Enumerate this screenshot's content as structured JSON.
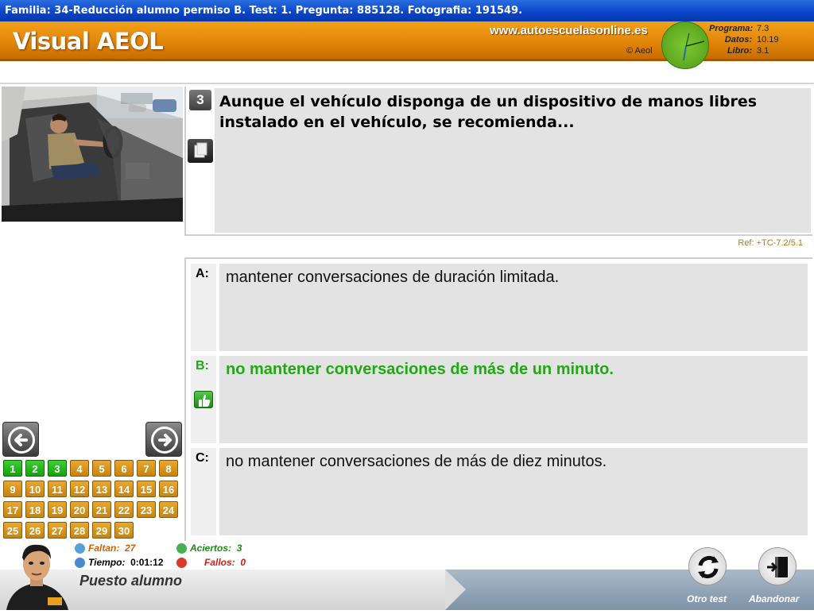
{
  "window": {
    "title": "Familia: 34-Reducción alumno permiso B. Test: 1. Pregunta: 885128. Fotografia: 191549."
  },
  "header": {
    "app_title": "Visual AEOL",
    "site": "www.autoescuelasonline.es",
    "copyright": "© Aeol",
    "version": {
      "programa_label": "Programa:",
      "programa_value": "7.3",
      "datos_label": "Datos:",
      "datos_value": "10.19",
      "libro_label": "Libro:",
      "libro_value": "3.1"
    }
  },
  "question": {
    "number": "3",
    "text": "Aunque el vehículo disponga de un dispositivo de manos libres instalado en el vehículo, se recomienda...",
    "ref": "Ref: +TC-7.2/5.1"
  },
  "answers": [
    {
      "letter": "A:",
      "text": "mantener conversaciones de duración limitada."
    },
    {
      "letter": "B:",
      "text": "no mantener conversaciones de más de un minuto."
    },
    {
      "letter": "C:",
      "text": "no mantener conversaciones de más de diez minutos."
    }
  ],
  "grid": {
    "cells": [
      "1",
      "2",
      "3",
      "4",
      "5",
      "6",
      "7",
      "8",
      "9",
      "10",
      "11",
      "12",
      "13",
      "14",
      "15",
      "16",
      "17",
      "18",
      "19",
      "20",
      "21",
      "22",
      "23",
      "24",
      "25",
      "26",
      "27",
      "28",
      "29",
      "30"
    ],
    "answered_count": 3
  },
  "stats": {
    "faltan_label": "Faltan:",
    "faltan_value": "27",
    "tiempo_label": "Tiempo:",
    "tiempo_value": "0:01:12",
    "aciertos_label": "Aciertos:",
    "aciertos_value": "3",
    "fallos_label": "Fallos:",
    "fallos_value": "0"
  },
  "footer": {
    "label": "Puesto alumno",
    "otro_test": "Otro test",
    "abandonar": "Abandonar"
  },
  "colors": {
    "header_orange": "#e2860a",
    "correct_green": "#1eaa10",
    "titlebar_blue": "#0a44c8"
  }
}
